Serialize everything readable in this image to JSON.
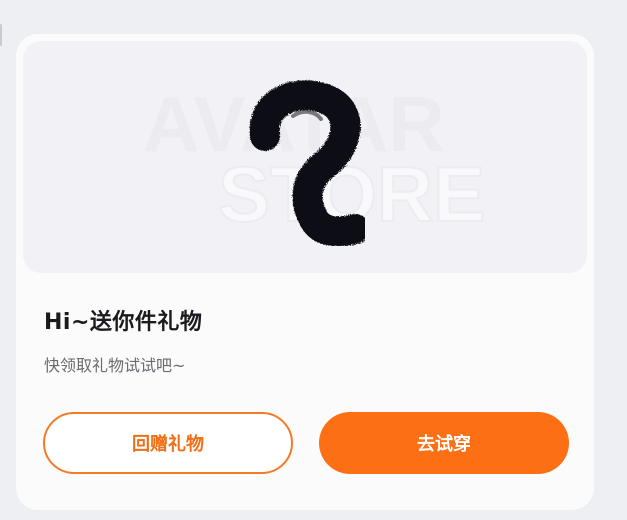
{
  "watermark": {
    "line1": "AVATAR",
    "line2": "STORE"
  },
  "gift": {
    "title": "Hi~送你件礼物",
    "subtitle": "快领取礼物试试吧~",
    "return_gift_label": "回赠礼物",
    "try_on_label": "去试穿"
  },
  "colors": {
    "accent": "#fd6f14",
    "outline": "#f47a26",
    "card": "#fbfbfc",
    "preview_bg": "#f2f2f6"
  },
  "icons": {
    "item": "fluffy-tail-icon"
  }
}
